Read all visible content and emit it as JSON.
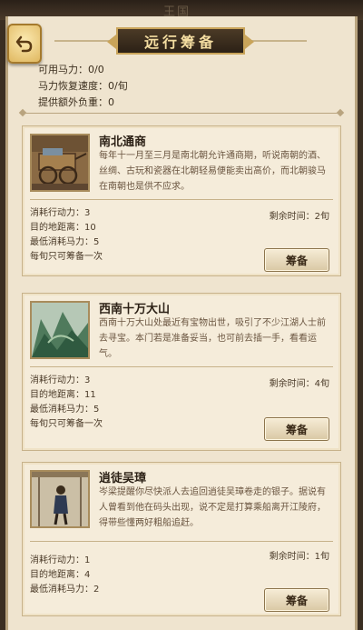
{
  "header": {
    "ghost_text": "王国",
    "title": "远行筹备"
  },
  "stats": [
    "可用马力：0/0",
    "马力恢复速度：0/旬",
    "提供额外负重：0"
  ],
  "expeditions": [
    {
      "name": "南北通商",
      "description": "每年十一月至三月是南北朝允许通商期，听说南朝的酒、丝绸、古玩和瓷器在北朝轻易便能卖出高价，而北朝骏马在南朝也是供不应求。",
      "action_cost": "消耗行动力：3",
      "distance": "目的地距离：10",
      "min_horse": "最低消耗马力：5",
      "limit": "每旬只可筹备一次",
      "time_left": "剩余时间：2旬",
      "button": "筹备"
    },
    {
      "name": "西南十万大山",
      "description": "西南十万大山处最近有宝物出世，吸引了不少江湖人士前去寻宝。本门若是准备妥当，也可前去插一手，看看运气。",
      "action_cost": "消耗行动力：3",
      "distance": "目的地距离：11",
      "min_horse": "最低消耗马力：5",
      "limit": "每旬只可筹备一次",
      "time_left": "剩余时间：4旬",
      "button": "筹备"
    },
    {
      "name": "逍徒吴璋",
      "description": "岑梁提醒你尽快派人去追回逍徒吴璋卷走的银子。据说有人曾看到他在码头出现，说不定是打算乘船离开江陵府，得带些懂两好粗船追赶。",
      "action_cost": "消耗行动力：1",
      "distance": "目的地距离：4",
      "min_horse": "最低消耗马力：2",
      "time_left": "剩余时间：1旬",
      "button": "筹备"
    }
  ],
  "icons": {
    "back": "back-arrow-icon"
  }
}
